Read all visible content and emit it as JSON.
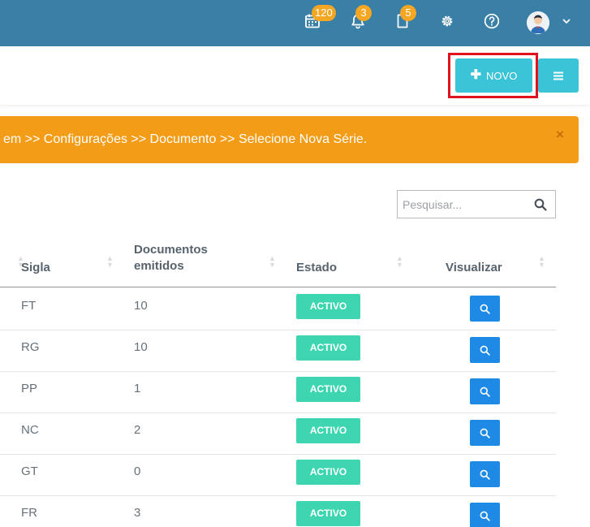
{
  "topbar": {
    "calendar_badge": "120",
    "notifications_badge": "3",
    "documents_badge": "5",
    "bg_color": "#3a7fa6",
    "badge_color": "#f5a623"
  },
  "toolbar": {
    "new_label": "NOVO",
    "new_icon": "plus-icon",
    "menu_icon": "hamburger-icon",
    "button_color": "#3bc3d8"
  },
  "alert": {
    "text": "em >> Configurações >> Documento >> Selecione Nova Série.",
    "close": "×",
    "color": "#f39c17"
  },
  "search": {
    "placeholder": "Pesquisar..."
  },
  "table": {
    "columns": {
      "sigla": "Sigla",
      "documentos_l1": "Documentos",
      "documentos_l2": "emitidos",
      "estado": "Estado",
      "visualizar": "Visualizar"
    },
    "rows": [
      {
        "sigla": "FT",
        "documentos": "10",
        "estado": "ACTIVO"
      },
      {
        "sigla": "RG",
        "documentos": "10",
        "estado": "ACTIVO"
      },
      {
        "sigla": "PP",
        "documentos": "1",
        "estado": "ACTIVO"
      },
      {
        "sigla": "NC",
        "documentos": "2",
        "estado": "ACTIVO"
      },
      {
        "sigla": "GT",
        "documentos": "0",
        "estado": "ACTIVO"
      },
      {
        "sigla": "FR",
        "documentos": "3",
        "estado": "ACTIVO"
      }
    ],
    "state_color": "#3ed6b1",
    "view_button_color": "#1e8ae6"
  }
}
